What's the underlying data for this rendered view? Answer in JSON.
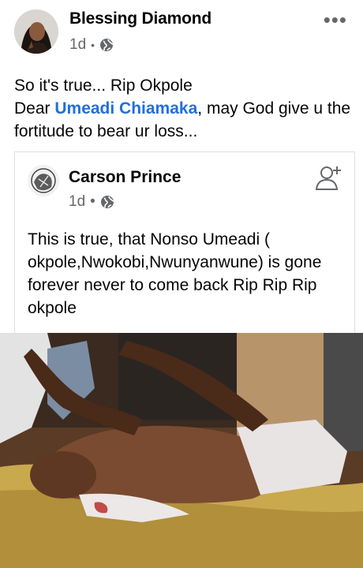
{
  "post": {
    "author": "Blessing Diamond",
    "time": "1d",
    "separator": "•",
    "privacy_icon": "globe-icon",
    "more_icon": "more-options-icon",
    "more_glyph": "•••",
    "text_line1": "So it's true... Rip Okpole",
    "text_prefix": "Dear ",
    "mention": "Umeadi Chiamaka",
    "text_suffix": ", may God give u the fortitude to bear ur loss..."
  },
  "shared": {
    "author": "Carson Prince",
    "time": "1d",
    "separator": "•",
    "privacy_icon": "globe-icon",
    "action_icon": "add-friend-icon",
    "text": "This is true, that Nonso Umeadi ( okpole,Nwokobi,Nwunyanwune) is gone forever never to come back Rip Rip Rip okpole"
  },
  "colors": {
    "mention": "#216fdb",
    "meta": "#65676b",
    "text": "#050505"
  }
}
